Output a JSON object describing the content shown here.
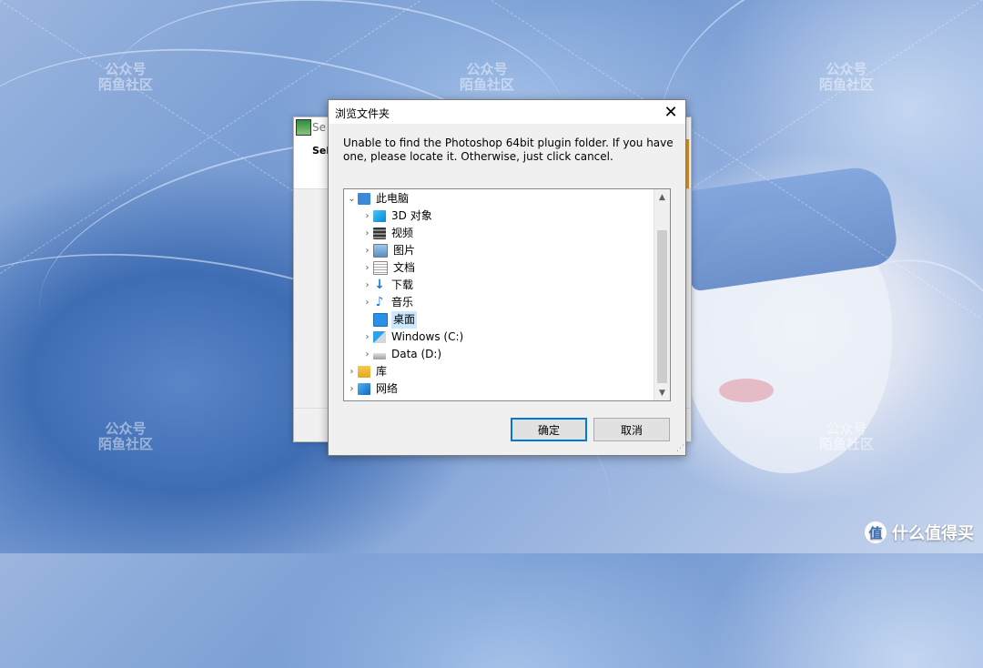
{
  "watermark": {
    "line1": "公众号",
    "line2": "陌鱼社区"
  },
  "back_window": {
    "title": "Se",
    "subtitle": "Sele"
  },
  "dialog": {
    "title": "浏览文件夹",
    "message": "Unable to find the Photoshop 64bit plugin folder. If you have one, please locate it. Otherwise, just click cancel.",
    "tree": [
      {
        "label": "此电脑",
        "icon": "pc-icon",
        "expanded": true
      },
      {
        "label": "3D 对象",
        "icon": "3d-objects-icon"
      },
      {
        "label": "视频",
        "icon": "video-icon"
      },
      {
        "label": "图片",
        "icon": "pictures-icon"
      },
      {
        "label": "文档",
        "icon": "documents-icon"
      },
      {
        "label": "下载",
        "icon": "downloads-icon"
      },
      {
        "label": "音乐",
        "icon": "music-icon"
      },
      {
        "label": "桌面",
        "icon": "desktop-icon",
        "selected": true
      },
      {
        "label": "Windows (C:)",
        "icon": "windows-drive-icon"
      },
      {
        "label": "Data (D:)",
        "icon": "drive-icon"
      },
      {
        "label": "库",
        "icon": "library-icon"
      },
      {
        "label": "网络",
        "icon": "network-icon"
      }
    ],
    "ok_label": "确定",
    "cancel_label": "取消"
  },
  "brand": {
    "symbol": "值",
    "text": "什么值得买"
  },
  "colors": {
    "accent": "#0078d7",
    "selection": "#cce8ff"
  }
}
